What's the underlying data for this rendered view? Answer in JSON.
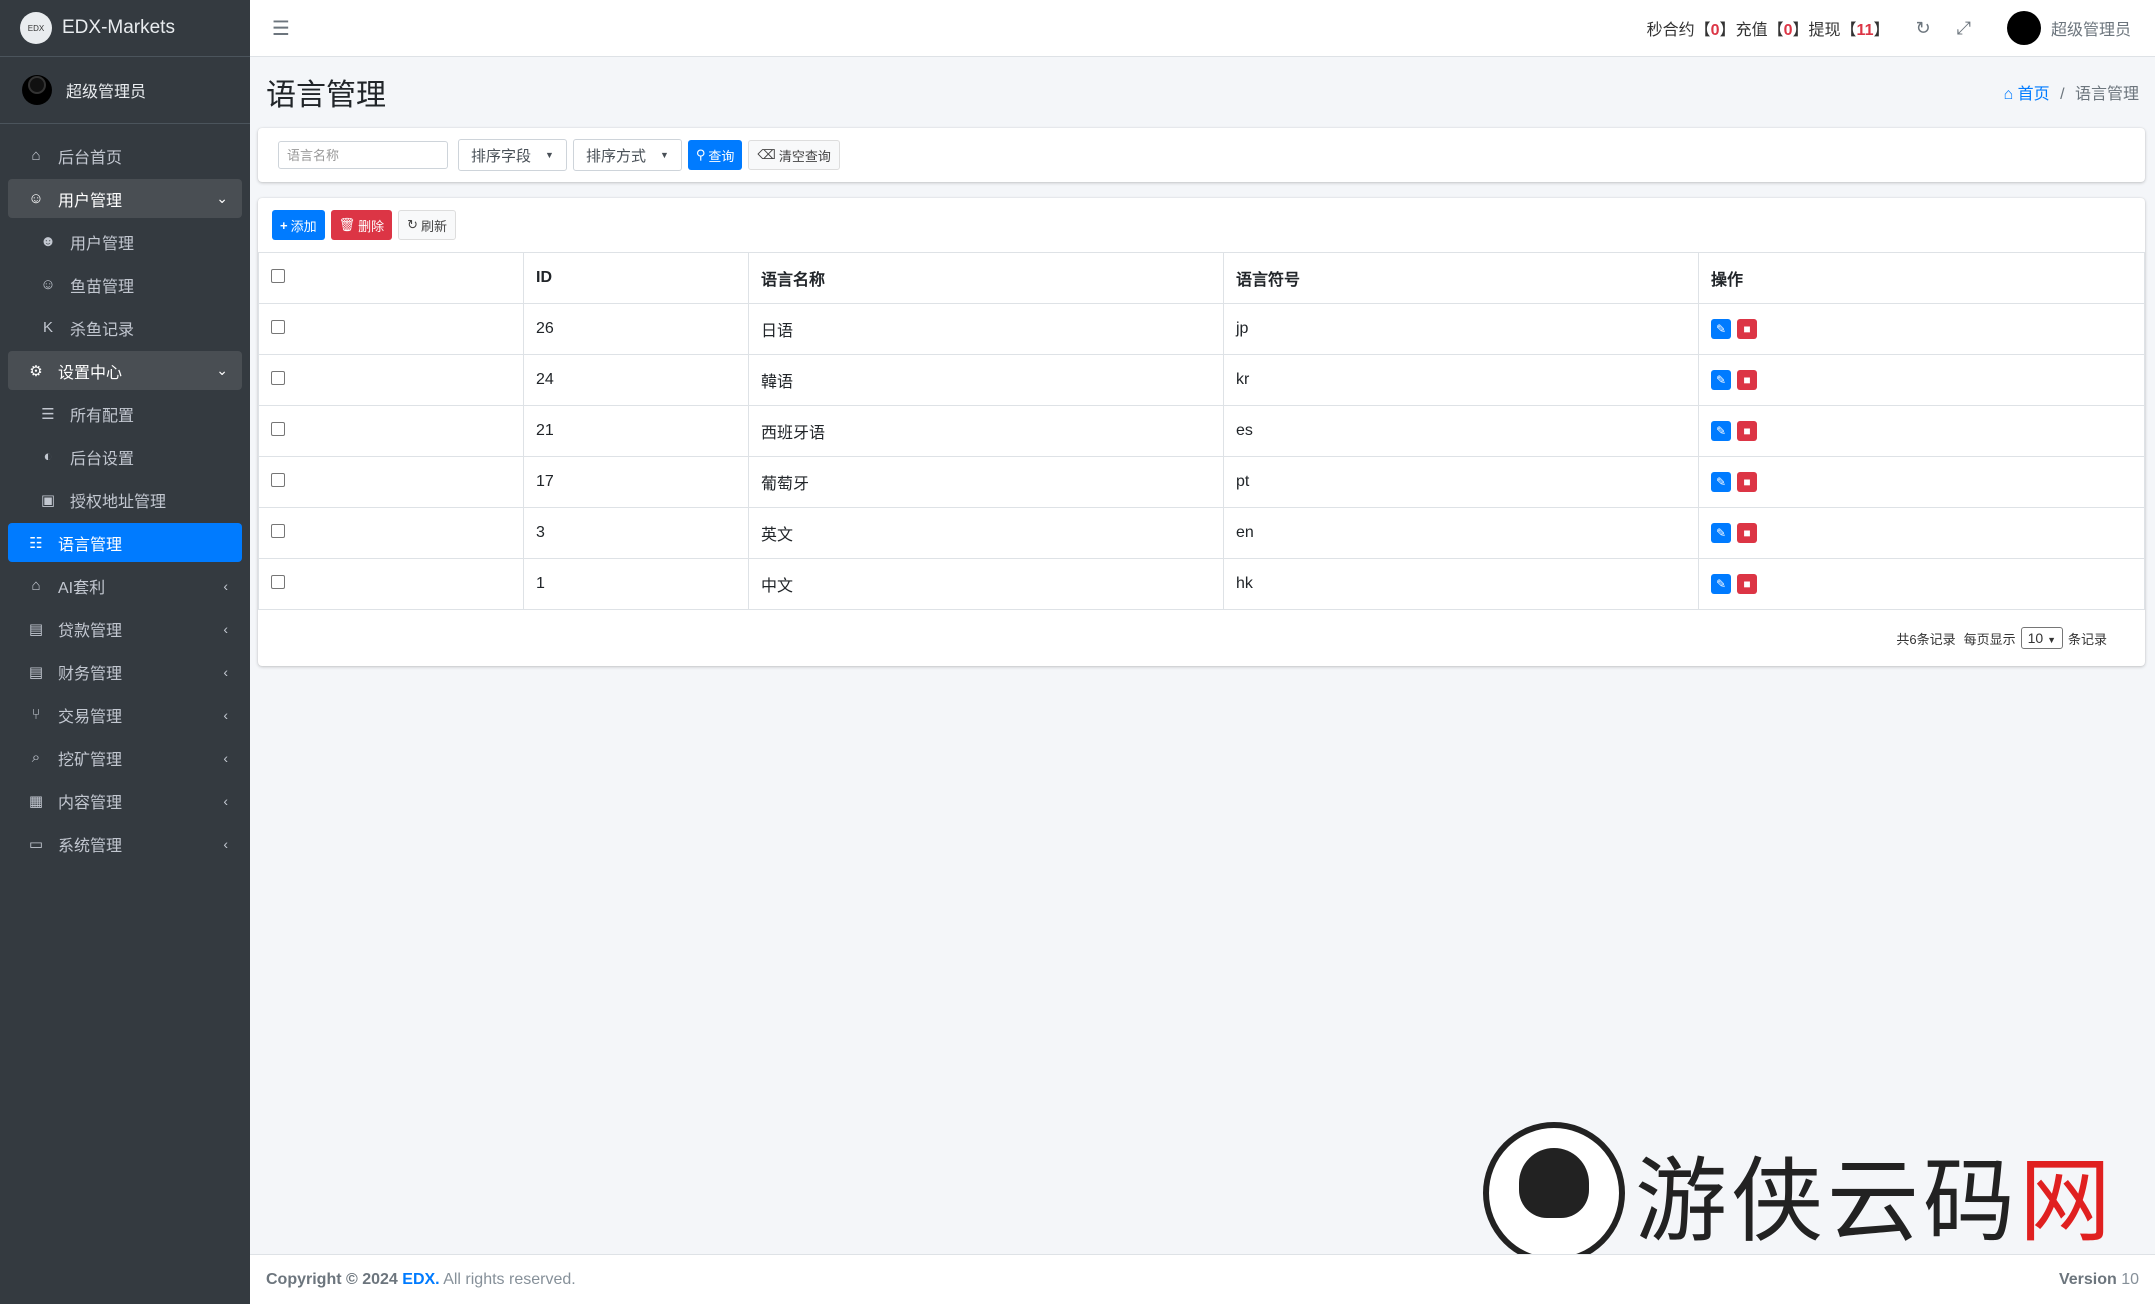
{
  "brand": {
    "logo": "EDX",
    "name": "EDX-Markets"
  },
  "sidebar": {
    "user": "超级管理员",
    "items": [
      {
        "label": "后台首页",
        "icon": "home-icon",
        "state": "normal"
      },
      {
        "label": "用户管理",
        "icon": "users-icon",
        "state": "open"
      },
      {
        "label": "用户管理",
        "icon": "user-icon",
        "state": "sub"
      },
      {
        "label": "鱼苗管理",
        "icon": "users-icon",
        "state": "sub"
      },
      {
        "label": "杀鱼记录",
        "icon": "k-icon",
        "state": "sub"
      },
      {
        "label": "设置中心",
        "icon": "cogs-icon",
        "state": "open"
      },
      {
        "label": "所有配置",
        "icon": "list-icon",
        "state": "sub"
      },
      {
        "label": "后台设置",
        "icon": "contrast-icon",
        "state": "sub"
      },
      {
        "label": "授权地址管理",
        "icon": "id-card-icon",
        "state": "sub"
      },
      {
        "label": "语言管理",
        "icon": "language-icon",
        "state": "active"
      },
      {
        "label": "AI套利",
        "icon": "android-icon",
        "state": "collapsed"
      },
      {
        "label": "贷款管理",
        "icon": "money-icon",
        "state": "collapsed"
      },
      {
        "label": "财务管理",
        "icon": "money-icon",
        "state": "collapsed"
      },
      {
        "label": "交易管理",
        "icon": "network-icon",
        "state": "collapsed"
      },
      {
        "label": "挖矿管理",
        "icon": "search-icon",
        "state": "collapsed"
      },
      {
        "label": "内容管理",
        "icon": "newspaper-icon",
        "state": "collapsed"
      },
      {
        "label": "系统管理",
        "icon": "desktop-icon",
        "state": "collapsed"
      }
    ]
  },
  "topbar": {
    "stat1_label": "秒合约",
    "stat1_value": "0",
    "stat2_label": "充值",
    "stat2_value": "0",
    "stat3_label": "提现",
    "stat3_value": "11",
    "user": "超级管理员"
  },
  "page": {
    "title": "语言管理",
    "breadcrumb_home": "首页",
    "breadcrumb_current": "语言管理"
  },
  "filter": {
    "name_placeholder": "语言名称",
    "sort_field": "排序字段",
    "sort_order": "排序方式",
    "query": "查询",
    "clear": "清空查询"
  },
  "toolbar": {
    "add": "添加",
    "delete": "删除",
    "refresh": "刷新"
  },
  "table": {
    "headers": [
      "ID",
      "语言名称",
      "语言符号",
      "操作"
    ],
    "rows": [
      {
        "id": "26",
        "name": "日语",
        "symbol": "jp"
      },
      {
        "id": "24",
        "name": "韓语",
        "symbol": "kr"
      },
      {
        "id": "21",
        "name": "西班牙语",
        "symbol": "es"
      },
      {
        "id": "17",
        "name": "葡萄牙",
        "symbol": "pt"
      },
      {
        "id": "3",
        "name": "英文",
        "symbol": "en"
      },
      {
        "id": "1",
        "name": "中文",
        "symbol": "hk"
      }
    ]
  },
  "pager": {
    "total": "共6条记录",
    "per_page_label": "每页显示",
    "per_page": "10",
    "suffix": "条记录"
  },
  "footer": {
    "copyright": "Copyright © 2024",
    "brand": "EDX.",
    "rights": "All rights reserved.",
    "version_label": "Version",
    "version": "10"
  },
  "watermark": {
    "text": "游侠云码",
    "accent": "网"
  },
  "colors": {
    "primary": "#007bff",
    "danger": "#dc3545",
    "sidebar": "#343a40"
  }
}
